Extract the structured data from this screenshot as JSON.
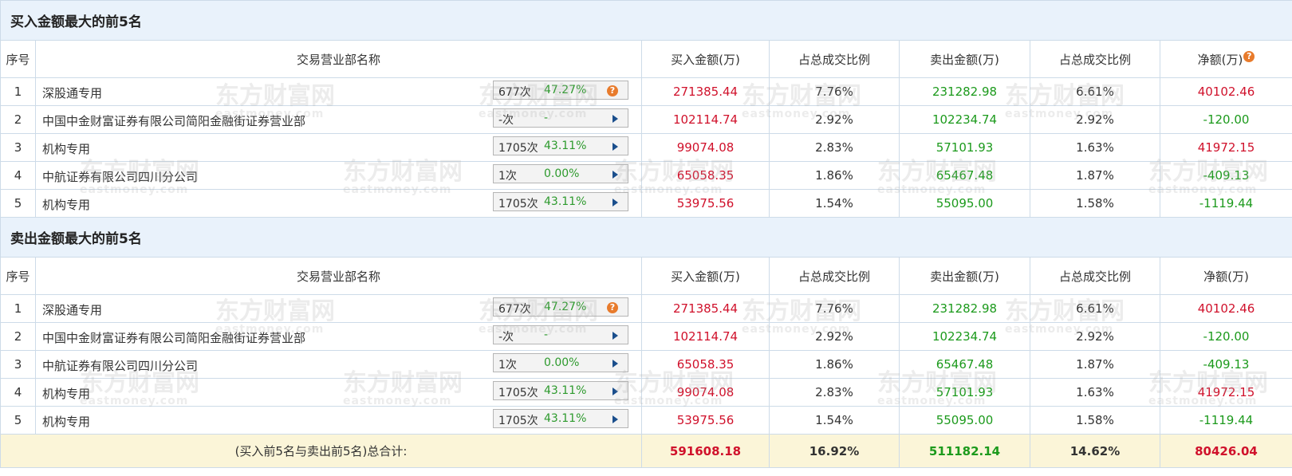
{
  "sections": [
    {
      "title": "买入金额最大的前5名",
      "headers": [
        "序号",
        "交易营业部名称",
        "买入金额(万)",
        "占总成交比例",
        "卖出金额(万)",
        "占总成交比例",
        "净额(万)"
      ],
      "net_help_icon": "question-icon",
      "rows": [
        {
          "idx": "1",
          "name": "深股通专用",
          "count": "677次",
          "pct": "47.27%",
          "tag_icon": "question-icon",
          "buy": "271385.44",
          "buy_ratio": "7.76%",
          "sell": "231282.98",
          "sell_ratio": "6.61%",
          "net": "40102.46",
          "net_color": "red"
        },
        {
          "idx": "2",
          "name": "中国中金财富证券有限公司简阳金融街证券营业部",
          "count": "-次",
          "pct": "-",
          "tag_icon": "arrow-right-icon",
          "buy": "102114.74",
          "buy_ratio": "2.92%",
          "sell": "102234.74",
          "sell_ratio": "2.92%",
          "net": "-120.00",
          "net_color": "green"
        },
        {
          "idx": "3",
          "name": "机构专用",
          "count": "1705次",
          "pct": "43.11%",
          "tag_icon": "arrow-right-icon",
          "buy": "99074.08",
          "buy_ratio": "2.83%",
          "sell": "57101.93",
          "sell_ratio": "1.63%",
          "net": "41972.15",
          "net_color": "red"
        },
        {
          "idx": "4",
          "name": "中航证券有限公司四川分公司",
          "count": "1次",
          "pct": "0.00%",
          "tag_icon": "arrow-right-icon",
          "buy": "65058.35",
          "buy_ratio": "1.86%",
          "sell": "65467.48",
          "sell_ratio": "1.87%",
          "net": "-409.13",
          "net_color": "green"
        },
        {
          "idx": "5",
          "name": "机构专用",
          "count": "1705次",
          "pct": "43.11%",
          "tag_icon": "arrow-right-icon",
          "buy": "53975.56",
          "buy_ratio": "1.54%",
          "sell": "55095.00",
          "sell_ratio": "1.58%",
          "net": "-1119.44",
          "net_color": "green"
        }
      ]
    },
    {
      "title": "卖出金额最大的前5名",
      "headers": [
        "序号",
        "交易营业部名称",
        "买入金额(万)",
        "占总成交比例",
        "卖出金额(万)",
        "占总成交比例",
        "净额(万)"
      ],
      "rows": [
        {
          "idx": "1",
          "name": "深股通专用",
          "count": "677次",
          "pct": "47.27%",
          "tag_icon": "question-icon",
          "buy": "271385.44",
          "buy_ratio": "7.76%",
          "sell": "231282.98",
          "sell_ratio": "6.61%",
          "net": "40102.46",
          "net_color": "red"
        },
        {
          "idx": "2",
          "name": "中国中金财富证券有限公司简阳金融街证券营业部",
          "count": "-次",
          "pct": "-",
          "tag_icon": "arrow-right-icon",
          "buy": "102114.74",
          "buy_ratio": "2.92%",
          "sell": "102234.74",
          "sell_ratio": "2.92%",
          "net": "-120.00",
          "net_color": "green"
        },
        {
          "idx": "3",
          "name": "中航证券有限公司四川分公司",
          "count": "1次",
          "pct": "0.00%",
          "tag_icon": "arrow-right-icon",
          "buy": "65058.35",
          "buy_ratio": "1.86%",
          "sell": "65467.48",
          "sell_ratio": "1.87%",
          "net": "-409.13",
          "net_color": "green"
        },
        {
          "idx": "4",
          "name": "机构专用",
          "count": "1705次",
          "pct": "43.11%",
          "tag_icon": "arrow-right-icon",
          "buy": "99074.08",
          "buy_ratio": "2.83%",
          "sell": "57101.93",
          "sell_ratio": "1.63%",
          "net": "41972.15",
          "net_color": "red"
        },
        {
          "idx": "5",
          "name": "机构专用",
          "count": "1705次",
          "pct": "43.11%",
          "tag_icon": "arrow-right-icon",
          "buy": "53975.56",
          "buy_ratio": "1.54%",
          "sell": "55095.00",
          "sell_ratio": "1.58%",
          "net": "-1119.44",
          "net_color": "green"
        }
      ]
    }
  ],
  "total": {
    "label": "(买入前5名与卖出前5名)总合计:",
    "buy": "591608.18",
    "buy_ratio": "16.92%",
    "sell": "511182.14",
    "sell_ratio": "14.62%",
    "net": "80426.04"
  },
  "watermark": {
    "text": "东方财富网",
    "sub": "eastmoney.com"
  },
  "colors": {
    "red": "#d0112b",
    "green": "#1c9a1c",
    "header_bg": "#e9f2fb",
    "total_bg": "#fbf5d8",
    "border": "#cddbe8"
  }
}
